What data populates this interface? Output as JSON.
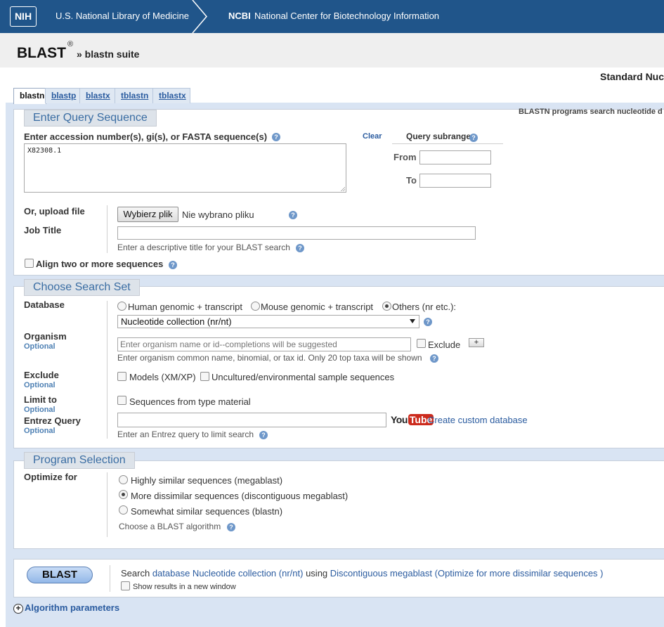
{
  "banner": {
    "nih_logo": "NIH",
    "nlm": "U.S. National Library of Medicine",
    "ncbi_abbrev": "NCBI",
    "ncbi_full": "National Center for Biotechnology Information"
  },
  "header": {
    "title": "BLAST",
    "registered": "®",
    "suite": "» blastn suite",
    "standard": "Standard Nuc"
  },
  "tabs": [
    {
      "label": "blastn",
      "active": true
    },
    {
      "label": "blastp"
    },
    {
      "label": "blastx"
    },
    {
      "label": "tblastn"
    },
    {
      "label": "tblastx"
    }
  ],
  "query": {
    "legend": "Enter Query Sequence",
    "description_right": "BLASTN programs search nucleotide d",
    "sequence_label": "Enter accession number(s), gi(s), or FASTA sequence(s)",
    "sequence_value": "X82308.1",
    "clear": "Clear",
    "subrange_label": "Query subrange",
    "from_label": "From",
    "to_label": "To",
    "upload_label": "Or, upload file",
    "choose_file": "Wybierz plik",
    "no_file": "Nie wybrano pliku",
    "job_title_label": "Job Title",
    "job_title_hint": "Enter a descriptive title for your BLAST search",
    "align_label": "Align two or more sequences"
  },
  "search_set": {
    "legend": "Choose Search Set",
    "database_label": "Database",
    "db_options": [
      "Human genomic + transcript",
      "Mouse genomic + transcript",
      "Others (nr etc.):"
    ],
    "db_selected": "Nucleotide collection (nr/nt)",
    "organism_label": "Organism",
    "optional": "Optional",
    "organism_placeholder": "Enter organism name or id--completions will be suggested",
    "exclude_checkbox": "Exclude",
    "plus": "+",
    "organism_hint": "Enter organism common name, binomial, or tax id. Only 20 top taxa will be shown",
    "exclude_label": "Exclude",
    "exclude_models": "Models (XM/XP)",
    "exclude_uncultured": "Uncultured/environmental sample sequences",
    "limit_label": "Limit to",
    "limit_type": "Sequences from type material",
    "entrez_label": "Entrez Query",
    "youtube_you": "You",
    "youtube_tube": "Tube",
    "custom_db": "Create custom database",
    "entrez_hint": "Enter an Entrez query to limit search"
  },
  "program": {
    "legend": "Program Selection",
    "optimize_label": "Optimize for",
    "options": [
      "Highly similar sequences (megablast)",
      "More dissimilar sequences (discontiguous megablast)",
      "Somewhat similar sequences (blastn)"
    ],
    "selected_index": 1,
    "choose_hint": "Choose a BLAST algorithm"
  },
  "submit": {
    "button": "BLAST",
    "search": "Search",
    "database_text": "database Nucleotide collection (nr/nt)",
    "using": "using",
    "algorithm_text": "Discontiguous megablast (Optimize for more dissimilar sequences )",
    "new_window": "Show results in a new window"
  },
  "algo_params": {
    "icon": "+",
    "label": "Algorithm parameters"
  }
}
